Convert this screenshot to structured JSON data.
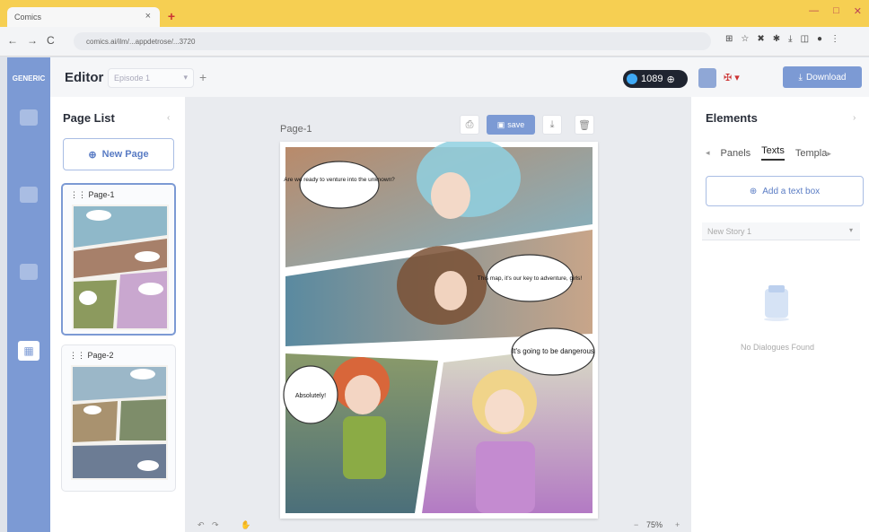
{
  "browser": {
    "tab_title": "Comics",
    "url": "comics.ai/ilm/...appdetrose/...3720",
    "nav": [
      "←",
      "→",
      "C"
    ]
  },
  "rail": {
    "logo": "GENERIC"
  },
  "header": {
    "title": "Editor",
    "episode_select": "Episode 1",
    "credits": "1089",
    "download_label": "Download"
  },
  "page_list": {
    "title": "Page List",
    "new_page_label": "New Page",
    "pages": [
      {
        "label": "Page-1"
      },
      {
        "label": "Page-2"
      }
    ]
  },
  "canvas": {
    "page_label": "Page-1",
    "save_label": "save",
    "zoom": "75%",
    "bubbles": [
      "Are we ready to venture into the unknown?",
      "This map, it's our key to adventure, girls!",
      "It's going to be dangerous",
      "Absolutely!"
    ]
  },
  "elements": {
    "title": "Elements",
    "tabs": [
      "Panels",
      "Texts",
      "Templa"
    ],
    "active_tab": "Texts",
    "add_text_label": "Add a text box",
    "story_select": "New Story 1",
    "empty_text": "No Dialogues Found"
  },
  "colors": {
    "accent": "#7c9ad4",
    "chrome_tab_bar": "#f6cf52",
    "dark_pill": "#1f2430"
  }
}
